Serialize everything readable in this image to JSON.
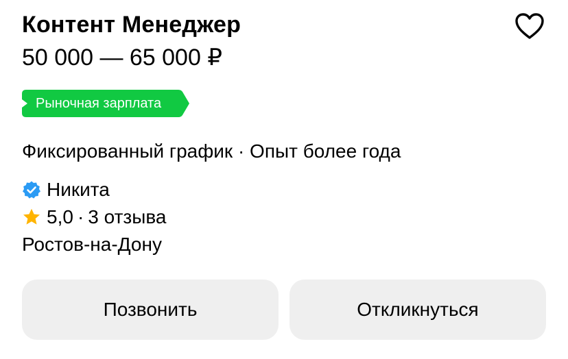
{
  "vacancy": {
    "title": "Контент Менеджер",
    "salary": "50 000 — 65 000 ₽",
    "badge": "Рыночная зарплата",
    "conditions": "Фиксированный график · Опыт более года",
    "employer_name": "Никита",
    "rating_value": "5,0",
    "rating_separator": "·",
    "reviews": "3 отзыва",
    "location": "Ростов-на-Дону"
  },
  "actions": {
    "call_label": "Позвонить",
    "apply_label": "Откликнуться"
  },
  "icons": {
    "favorite": "heart-outline-icon",
    "verified": "verified-badge-icon",
    "rating": "star-icon"
  },
  "colors": {
    "badge_bg": "#11c942",
    "verified": "#2b9bf4",
    "star": "#ffb400",
    "button_bg": "#efefef",
    "text": "#000000"
  }
}
